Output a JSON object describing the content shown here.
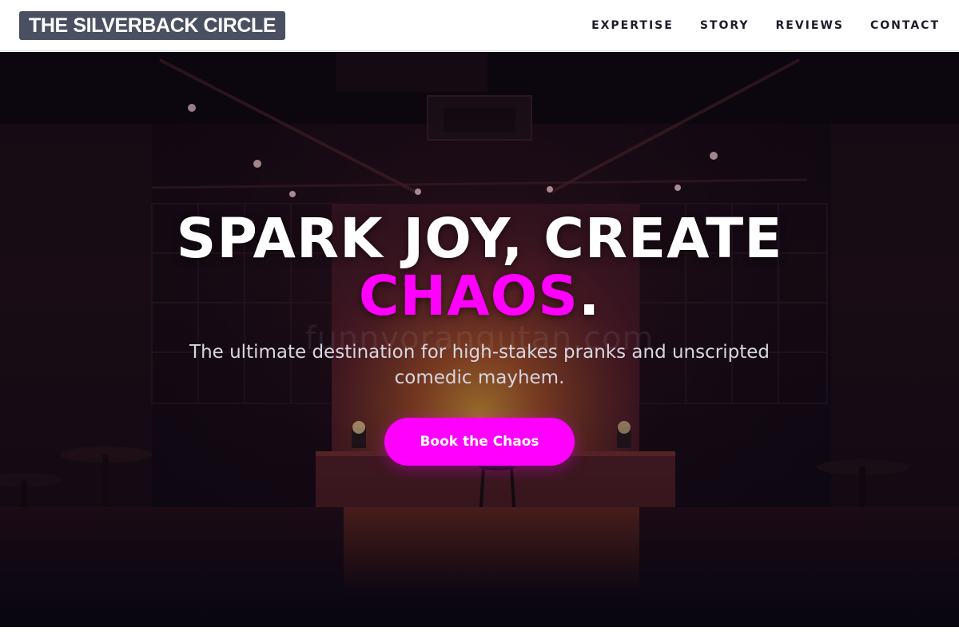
{
  "header": {
    "logo": "THE SILVERBACK CIRCLE",
    "nav": [
      {
        "label": "EXPERTISE"
      },
      {
        "label": "STORY"
      },
      {
        "label": "REVIEWS"
      },
      {
        "label": "CONTACT"
      }
    ]
  },
  "hero": {
    "title_line1": "SPARK JOY, CREATE",
    "title_accent": "CHAOS",
    "title_period": ".",
    "subtitle": "The ultimate destination for high-stakes pranks and unscripted comedic mayhem.",
    "cta_label": "Book the Chaos",
    "watermark": "funnyorangutan.com"
  },
  "colors": {
    "accent": "#ff00ff",
    "logo_bg": "#4a5062",
    "nav_text": "#1c1c2a",
    "hero_bg": "#0d0810"
  }
}
